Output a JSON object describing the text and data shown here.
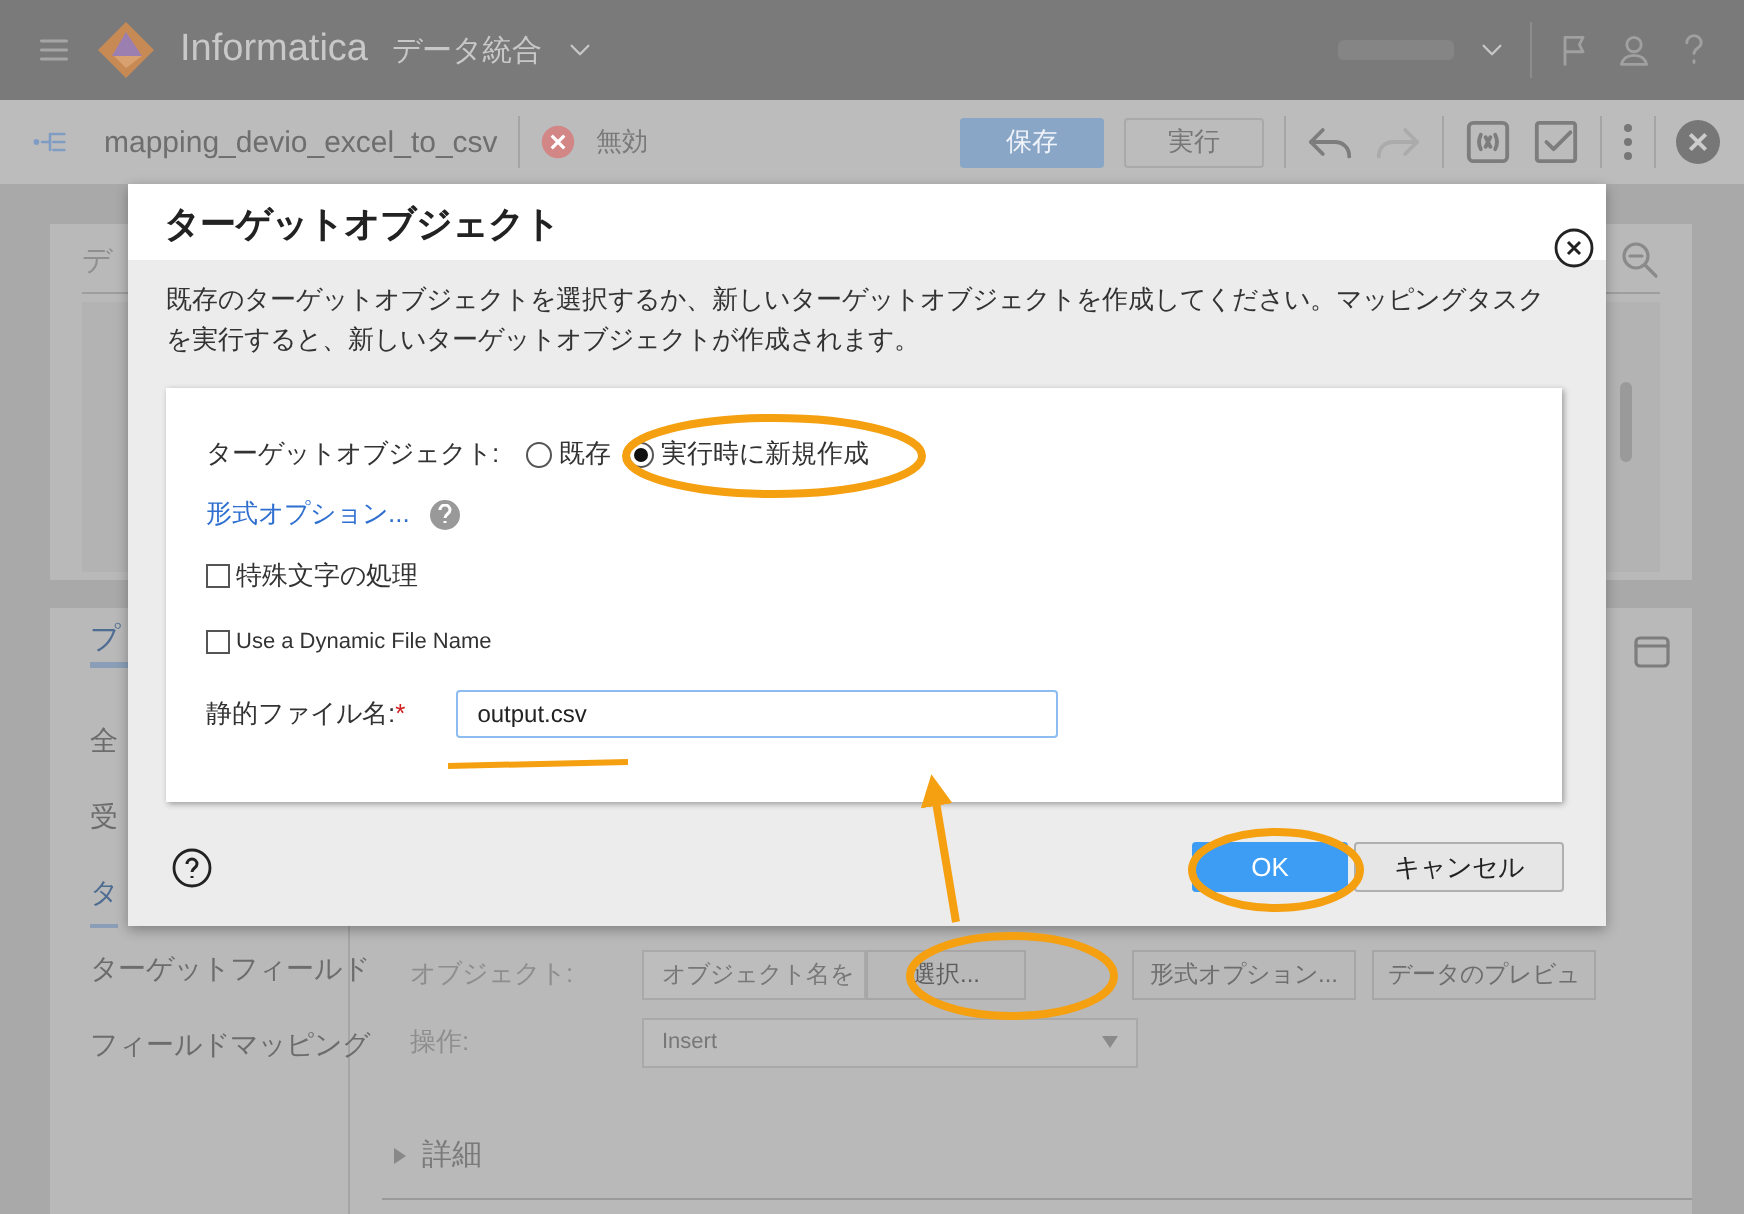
{
  "header": {
    "product": "Informatica",
    "app": "データ統合"
  },
  "toolbar": {
    "mapping_name": "mapping_devio_excel_to_csv",
    "status": "無効",
    "save": "保存",
    "run": "実行"
  },
  "background": {
    "design_title": "デ",
    "properties_tab": "プ",
    "nav_items": [
      {
        "label": "全",
        "selected": false
      },
      {
        "label": "受",
        "selected": false
      },
      {
        "label": "タ",
        "selected": true
      },
      {
        "label": "ターゲットフィールド",
        "selected": false
      },
      {
        "label": "フィールドマッピング",
        "selected": false
      }
    ],
    "object_label": "オブジェクト:",
    "object_field": "オブジェクト名を",
    "select_button": "選択...",
    "format_button": "形式オプション...",
    "preview_button": "データのプレビュ",
    "operation_label": "操作:",
    "operation_value": "Insert",
    "details": "詳細"
  },
  "dialog": {
    "title": "ターゲットオブジェクト",
    "description": "既存のターゲットオブジェクトを選択するか、新しいターゲットオブジェクトを作成してください。マッピングタスクを実行すると、新しいターゲットオブジェクトが作成されます。",
    "target_label": "ターゲットオブジェクト:",
    "options": [
      {
        "label": "既存",
        "selected": false
      },
      {
        "label": "実行時に新規作成",
        "selected": true
      }
    ],
    "format_link": "形式オプション...",
    "checkboxes": [
      {
        "label": "特殊文字の処理",
        "checked": false
      },
      {
        "label": "Use a Dynamic File Name",
        "checked": false
      }
    ],
    "file_label": "静的ファイル名:",
    "required_mark": "*",
    "file_value": "output.csv",
    "ok": "OK",
    "cancel": "キャンセル"
  }
}
